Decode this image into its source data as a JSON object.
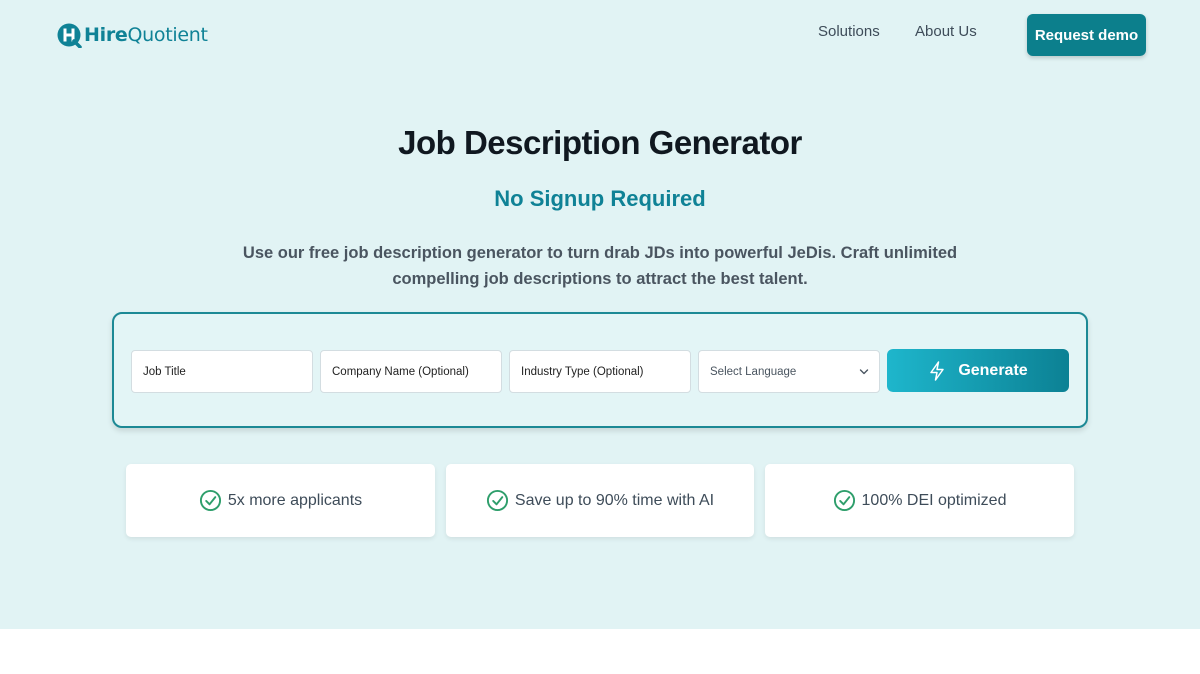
{
  "header": {
    "logo": {
      "part1": "Hire",
      "part2": "Quotient",
      "icon": "hirequotient-logo-icon"
    },
    "nav": [
      {
        "label": "Solutions"
      },
      {
        "label": "About Us"
      }
    ],
    "cta_label": "Request demo"
  },
  "hero": {
    "title": "Job Description Generator",
    "subtitle": "No Signup Required",
    "description": "Use our free job description generator to turn drab JDs into powerful JeDis. Craft unlimited compelling job descriptions to attract the best talent."
  },
  "form": {
    "job_title_placeholder": "Job Title",
    "company_placeholder": "Company Name (Optional)",
    "industry_placeholder": "Industry Type (Optional)",
    "language_selected": "Select Language",
    "generate_label": "Generate",
    "generate_icon": "lightning-bolt-icon",
    "select_icon": "chevron-down-icon"
  },
  "features": [
    {
      "label": "5x more applicants",
      "icon": "check-circle-icon"
    },
    {
      "label": "Save up to 90% time with AI",
      "icon": "check-circle-icon"
    },
    {
      "label": "100% DEI optimized",
      "icon": "check-circle-icon"
    }
  ],
  "colors": {
    "hero_bg": "#e1f3f4",
    "brand_teal": "#0f8296",
    "button_teal": "#0c7f8c",
    "check_green": "#2e9e6b",
    "title_dark": "#101820"
  }
}
